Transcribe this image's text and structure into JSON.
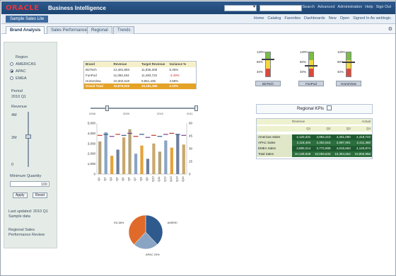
{
  "header": {
    "logo": "ORACLE",
    "product": "Business Intelligence",
    "search_scope": "All",
    "links": [
      "Search",
      "Advanced",
      "Administration",
      "Help",
      "Sign Out"
    ]
  },
  "subheader": {
    "dashboard_title": "Sample Sales Lite",
    "nav": [
      "Home",
      "Catalog",
      "Favorites",
      "Dashboards",
      "New",
      "Open",
      "Signed In As weblogic"
    ]
  },
  "tabs": [
    {
      "label": "Brand Analysis",
      "active": true
    },
    {
      "label": "Sales Performance",
      "active": false
    },
    {
      "label": "Regional",
      "active": false
    },
    {
      "label": "Trends",
      "active": false
    }
  ],
  "prompts": {
    "region_label": "Region",
    "region_options": [
      "AMERICAS",
      "APAC",
      "EMEA"
    ],
    "period_label": "Period",
    "period_value": "2010 Q1",
    "slider_label": "Revenue",
    "slider_top": "4M",
    "slider_mid": "2M",
    "slider_bottom": "0",
    "qty_label": "Minimum Quantity",
    "qty_value": "100",
    "apply": "Apply",
    "reset": "Reset",
    "note_1": "Last updated: 2010 Q1 Sample data",
    "note_2": "Regional Sales Performance Review"
  },
  "pivot": {
    "headers": [
      "Brand",
      "Revenue",
      "Target Revenue",
      "Variance %"
    ],
    "rows": [
      [
        "BizTech",
        "12,481,893",
        "11,836,208",
        "5.45%"
      ],
      [
        "FunPod",
        "11,092,404",
        "11,493,722",
        "-3.49%"
      ],
      [
        "HomeView",
        "10,302,618",
        "9,851,436",
        "4.58%"
      ]
    ],
    "total": [
      "Grand Total",
      "33,876,915",
      "33,181,366",
      "2.10%"
    ]
  },
  "gauges": [
    {
      "label": "BizTech",
      "value": 0.72,
      "ticks": [
        "120%",
        "80%",
        "40%"
      ]
    },
    {
      "label": "FunPod",
      "value": 0.48,
      "ticks": [
        "120%",
        "80%",
        "40%"
      ]
    },
    {
      "label": "HomeView",
      "value": 0.6,
      "ticks": [
        "120%",
        "80%",
        "40%"
      ]
    }
  ],
  "range": {
    "ticks": [
      "2008",
      "2009",
      "2010",
      "2011"
    ]
  },
  "chart_data": {
    "type": "bar",
    "title": "",
    "categories": [
      "Q1",
      "Q2",
      "Q3",
      "Q4",
      "Q5",
      "Q6",
      "Q7",
      "Q8",
      "Q9",
      "Q10",
      "Q11",
      "Q12",
      "Q13",
      "Q14",
      "Q15"
    ],
    "series": [
      {
        "name": "Revenue",
        "values": [
          3.2,
          4.1,
          1.8,
          2.4,
          3.6,
          4.4,
          2.0,
          2.8,
          1.5,
          3.0,
          2.2,
          3.3,
          2.6,
          3.9,
          2.9
        ]
      },
      {
        "name": "Target",
        "values": [
          3.8,
          3.9,
          3.7,
          3.9,
          3.8,
          4.0,
          3.7,
          3.9,
          3.6,
          3.8,
          3.7,
          3.9,
          4.0,
          3.9,
          3.8
        ]
      }
    ],
    "yticks_left": [
      "5,000",
      "4,000",
      "3,000",
      "2,000",
      "1,000",
      "0"
    ],
    "yticks_right": [
      "60",
      "45",
      "30",
      "15",
      "0"
    ],
    "ylim": [
      0,
      5
    ]
  },
  "pie": {
    "labels": [
      "AMERICAS 38%",
      "APAC 24%",
      "EMEA 38%"
    ],
    "values": [
      38,
      24,
      38
    ],
    "colors": [
      "#2e5a8d",
      "#8aa4c4",
      "#e06a2a"
    ]
  },
  "scorecard": {
    "title": "Regional KPIs",
    "header_group": "Revenue",
    "sub_header": "Actual",
    "cols": [
      "Q1",
      "Q2",
      "Q3",
      "Q4"
    ],
    "rows": [
      {
        "label": "Americas Sales",
        "values": [
          "4,120,331",
          "3,984,210",
          "4,251,090",
          "4,418,722"
        ]
      },
      {
        "label": "APAC Sales",
        "values": [
          "2,118,404",
          "2,302,515",
          "2,087,901",
          "2,411,360"
        ]
      },
      {
        "label": "EMEA Sales",
        "values": [
          "3,890,214",
          "3,772,908",
          "4,015,663",
          "4,120,874"
        ]
      },
      {
        "label": "Total Sales",
        "values": [
          "10,128,949",
          "10,059,633",
          "10,354,654",
          "10,950,956"
        ]
      }
    ]
  }
}
